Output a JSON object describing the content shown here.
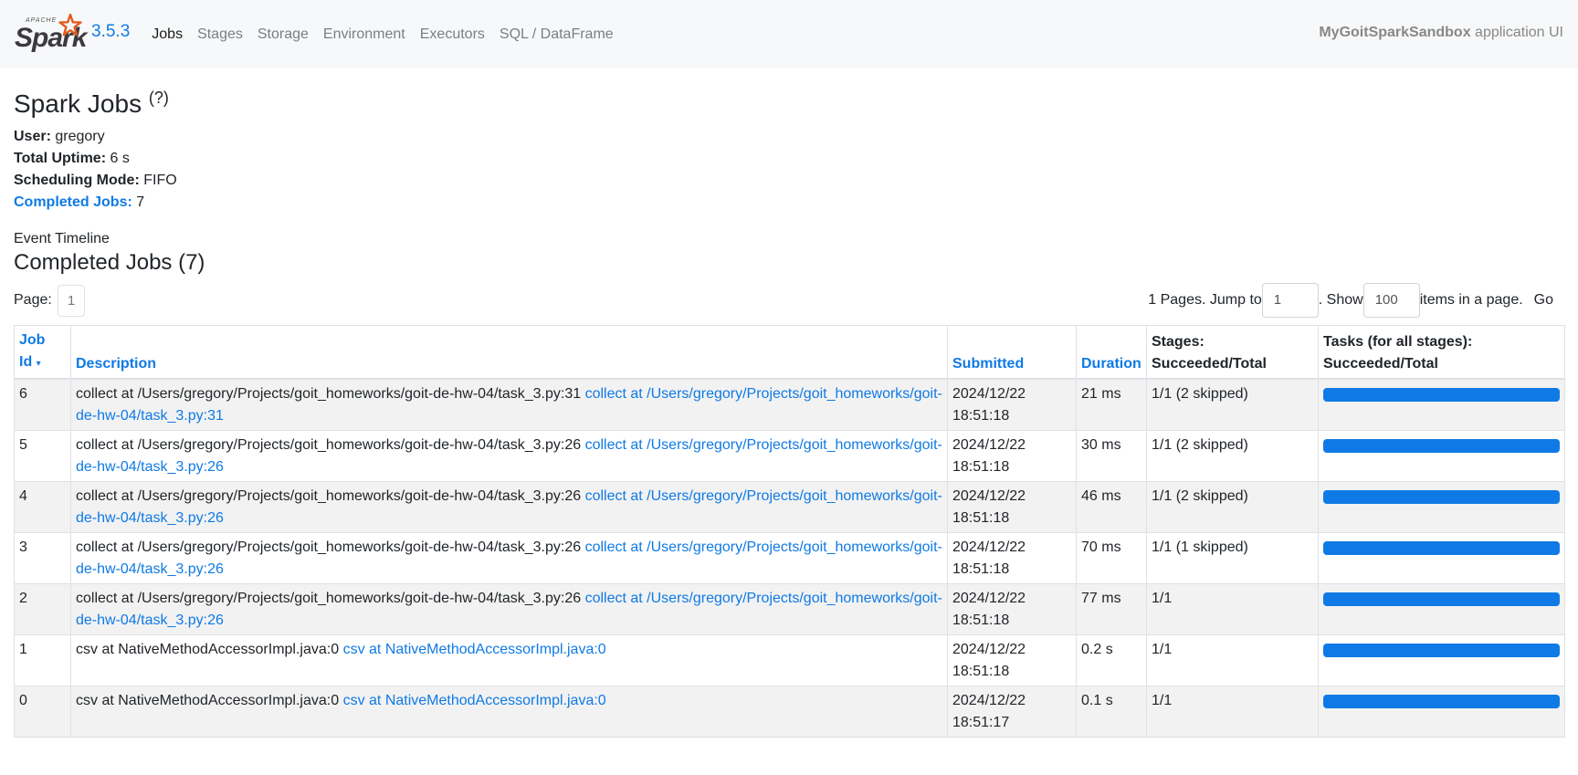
{
  "nav": {
    "version": "3.5.3",
    "tabs": [
      "Jobs",
      "Stages",
      "Storage",
      "Environment",
      "Executors",
      "SQL / DataFrame"
    ],
    "active_tab": "Jobs",
    "app_name": "MyGoitSparkSandbox",
    "app_suffix": "application UI",
    "logo_text": "Spark",
    "logo_apache": "APACHE"
  },
  "page": {
    "title": "Spark Jobs",
    "help": "(?)",
    "user_label": "User:",
    "user": "gregory",
    "uptime_label": "Total Uptime:",
    "uptime": "6 s",
    "mode_label": "Scheduling Mode:",
    "mode": "FIFO",
    "completed_label": "Completed Jobs:",
    "completed_count": "7",
    "event_timeline": "Event Timeline",
    "section_title": "Completed Jobs (7)"
  },
  "pager": {
    "page_label": "Page:",
    "page": "1",
    "pages_text": "1 Pages. Jump to",
    "jump_value": "1",
    "show_text": ". Show",
    "show_value": "100",
    "items_text": "items in a page.",
    "go": "Go"
  },
  "table": {
    "headers": {
      "job_id_1": "Job",
      "job_id_2": "Id",
      "sort_arrow": "▾",
      "description": "Description",
      "submitted": "Submitted",
      "duration": "Duration",
      "stages_1": "Stages:",
      "stages_2": "Succeeded/Total",
      "tasks_1": "Tasks (for all stages):",
      "tasks_2": "Succeeded/Total"
    },
    "rows": [
      {
        "id": "6",
        "desc": "collect at /Users/gregory/Projects/goit_homeworks/goit-de-hw-04/task_3.py:31",
        "link": "collect at /Users/gregory/Projects/goit_homeworks/goit-de-hw-04/task_3.py:31",
        "date": "2024/12/22",
        "time": "18:51:18",
        "duration": "21 ms",
        "stages": "1/1 (2 skipped)",
        "tasks_fraction": 1.0
      },
      {
        "id": "5",
        "desc": "collect at /Users/gregory/Projects/goit_homeworks/goit-de-hw-04/task_3.py:26",
        "link": "collect at /Users/gregory/Projects/goit_homeworks/goit-de-hw-04/task_3.py:26",
        "date": "2024/12/22",
        "time": "18:51:18",
        "duration": "30 ms",
        "stages": "1/1 (2 skipped)",
        "tasks_fraction": 1.0
      },
      {
        "id": "4",
        "desc": "collect at /Users/gregory/Projects/goit_homeworks/goit-de-hw-04/task_3.py:26",
        "link": "collect at /Users/gregory/Projects/goit_homeworks/goit-de-hw-04/task_3.py:26",
        "date": "2024/12/22",
        "time": "18:51:18",
        "duration": "46 ms",
        "stages": "1/1 (2 skipped)",
        "tasks_fraction": 1.0
      },
      {
        "id": "3",
        "desc": "collect at /Users/gregory/Projects/goit_homeworks/goit-de-hw-04/task_3.py:26",
        "link": "collect at /Users/gregory/Projects/goit_homeworks/goit-de-hw-04/task_3.py:26",
        "date": "2024/12/22",
        "time": "18:51:18",
        "duration": "70 ms",
        "stages": "1/1 (1 skipped)",
        "tasks_fraction": 1.0
      },
      {
        "id": "2",
        "desc": "collect at /Users/gregory/Projects/goit_homeworks/goit-de-hw-04/task_3.py:26",
        "link": "collect at /Users/gregory/Projects/goit_homeworks/goit-de-hw-04/task_3.py:26",
        "date": "2024/12/22",
        "time": "18:51:18",
        "duration": "77 ms",
        "stages": "1/1",
        "tasks_fraction": 1.0
      },
      {
        "id": "1",
        "desc": "csv at NativeMethodAccessorImpl.java:0",
        "link": "csv at NativeMethodAccessorImpl.java:0",
        "date": "2024/12/22",
        "time": "18:51:18",
        "duration": "0.2 s",
        "stages": "1/1",
        "tasks_fraction": 1.0
      },
      {
        "id": "0",
        "desc": "csv at NativeMethodAccessorImpl.java:0",
        "link": "csv at NativeMethodAccessorImpl.java:0",
        "date": "2024/12/22",
        "time": "18:51:17",
        "duration": "0.1 s",
        "stages": "1/1",
        "tasks_fraction": 1.0
      }
    ]
  },
  "colors": {
    "accent": "#0f7ae5",
    "logo_star": "#e25a1c"
  }
}
